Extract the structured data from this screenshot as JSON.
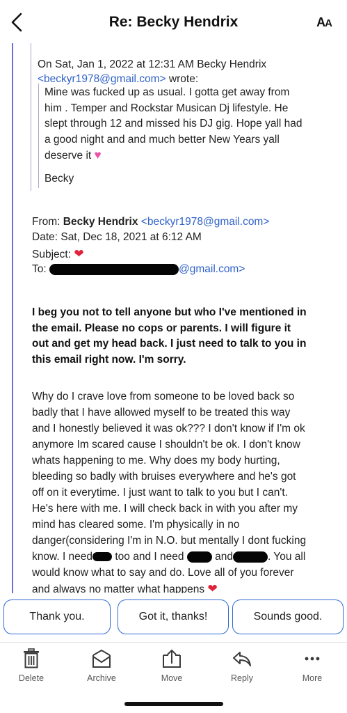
{
  "header": {
    "title": "Re: Becky Hendrix",
    "font_size_label_big": "A",
    "font_size_label_small": "A"
  },
  "quote": {
    "on_text": "On Sat, Jan 1, 2022 at 12:31 AM Becky Hendrix",
    "email_link": "<beckyr1978@gmail.com>",
    "wrote": " wrote:",
    "lines": [
      "Mine was fucked up as usual.  I gotta get away from",
      "him . Temper and Rockstar Musican Dj lifestyle. He",
      "slept through 12 and missed his DJ gig. Hope yall had",
      "a good night and and much better New Years yall",
      "deserve it"
    ],
    "signature": "Becky"
  },
  "meta": {
    "from_label": "From: ",
    "from_name": "Becky Hendrix",
    "from_email": "<beckyr1978@gmail.com>",
    "date_line": "Date: Sat, Dec 18, 2021 at 6:12 AM",
    "subject_label": "Subject: ",
    "to_label": "To: ",
    "to_email_suffix": "@gmail.com>"
  },
  "bold_paragraph": [
    "I beg you not to tell anyone but who I've mentioned in",
    "the email. Please no cops or parents. I will figure it",
    "out and get my head back. I just need to talk to you in",
    "this email right now. I'm sorry."
  ],
  "main_paragraph": {
    "lines": [
      "Why do I crave love from someone to be loved back so",
      "badly that I have allowed myself to be treated this way",
      "and I honestly believed it was ok??? I don't know if I'm ok",
      "anymore Im scared cause I shouldn't be ok. I don't know",
      "whats happening to me. Why does my body hurting,",
      "bleeding so badly with bruises everywhere and he's got",
      "off on it everytime. I just want to talk to you but I can't.",
      "He's here with me. I will check back in with you after my",
      "mind has cleared some. I'm physically in no",
      "danger(considering I'm in N.O. but mentally I dont fucking"
    ],
    "line11_a": "know. I need",
    "line11_b": " too and I need ",
    "line11_c": " and",
    "line11_d": ". You all",
    "line12": "would know what to say and do. Love all of you forever",
    "line13": "and always no matter what happens"
  },
  "quick_replies": [
    "Thank you.",
    "Got it, thanks!",
    "Sounds good."
  ],
  "toolbar": {
    "items": [
      {
        "label": "Delete",
        "icon": "trash-icon"
      },
      {
        "label": "Archive",
        "icon": "archive-icon"
      },
      {
        "label": "Move",
        "icon": "move-icon"
      },
      {
        "label": "Reply",
        "icon": "reply-icon"
      },
      {
        "label": "More",
        "icon": "more-icon"
      }
    ]
  },
  "colors": {
    "link": "#2f62c8",
    "accent_button_border": "#2e6ad1",
    "thread_line": "#6c6fd6",
    "heart_red": "#e0223a",
    "heart_pink": "#ee4fa6"
  }
}
